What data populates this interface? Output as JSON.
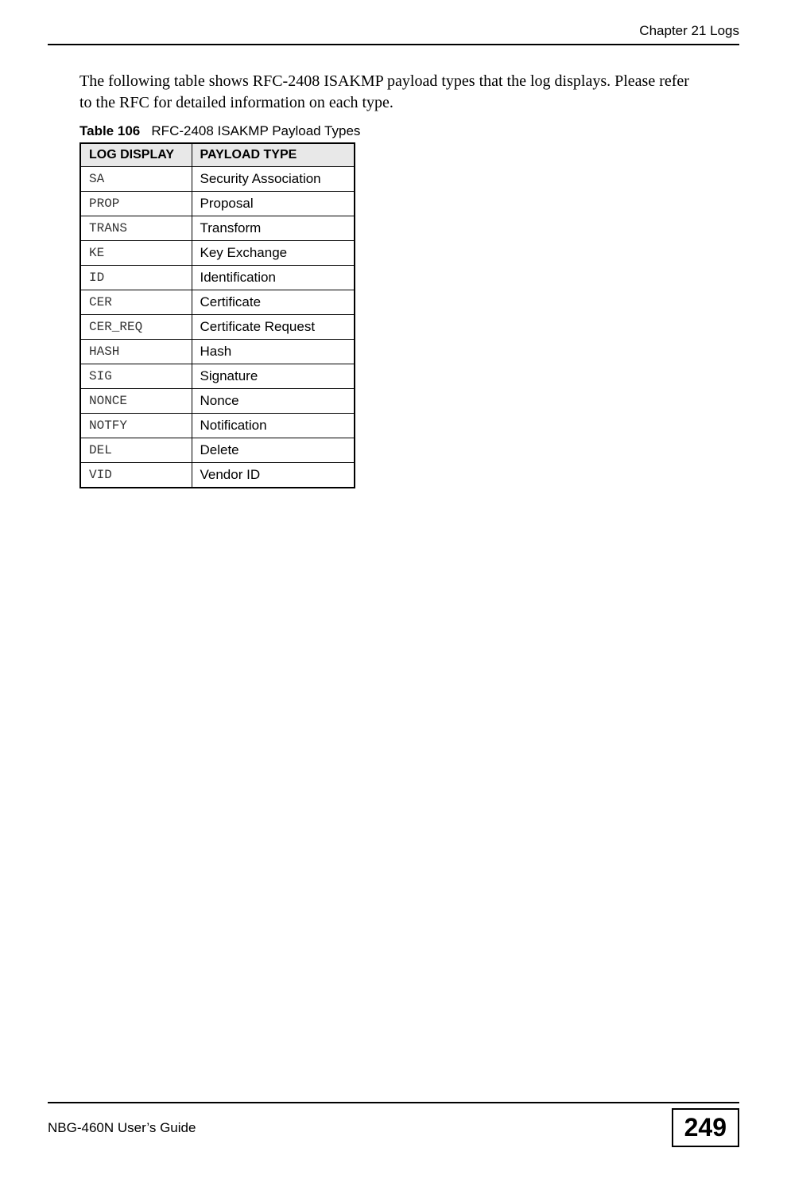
{
  "header": {
    "chapter": "Chapter 21 Logs"
  },
  "intro": "The following table shows RFC-2408 ISAKMP payload types that the log displays. Please refer to the RFC for detailed information on each type.",
  "table": {
    "caption_label": "Table 106",
    "caption_title": "RFC-2408 ISAKMP Payload Types",
    "col1": "LOG DISPLAY",
    "col2": "PAYLOAD TYPE",
    "rows": [
      {
        "code": "SA",
        "desc": "Security Association"
      },
      {
        "code": "PROP",
        "desc": "Proposal"
      },
      {
        "code": "TRANS",
        "desc": "Transform"
      },
      {
        "code": "KE",
        "desc": "Key Exchange"
      },
      {
        "code": "ID",
        "desc": "Identification"
      },
      {
        "code": "CER",
        "desc": "Certificate"
      },
      {
        "code": "CER_REQ",
        "desc": "Certificate Request"
      },
      {
        "code": "HASH",
        "desc": "Hash"
      },
      {
        "code": "SIG",
        "desc": "Signature"
      },
      {
        "code": "NONCE",
        "desc": "Nonce"
      },
      {
        "code": "NOTFY",
        "desc": "Notification"
      },
      {
        "code": "DEL",
        "desc": "Delete"
      },
      {
        "code": "VID",
        "desc": "Vendor ID"
      }
    ]
  },
  "footer": {
    "guide": "NBG-460N User’s Guide",
    "page": "249"
  }
}
